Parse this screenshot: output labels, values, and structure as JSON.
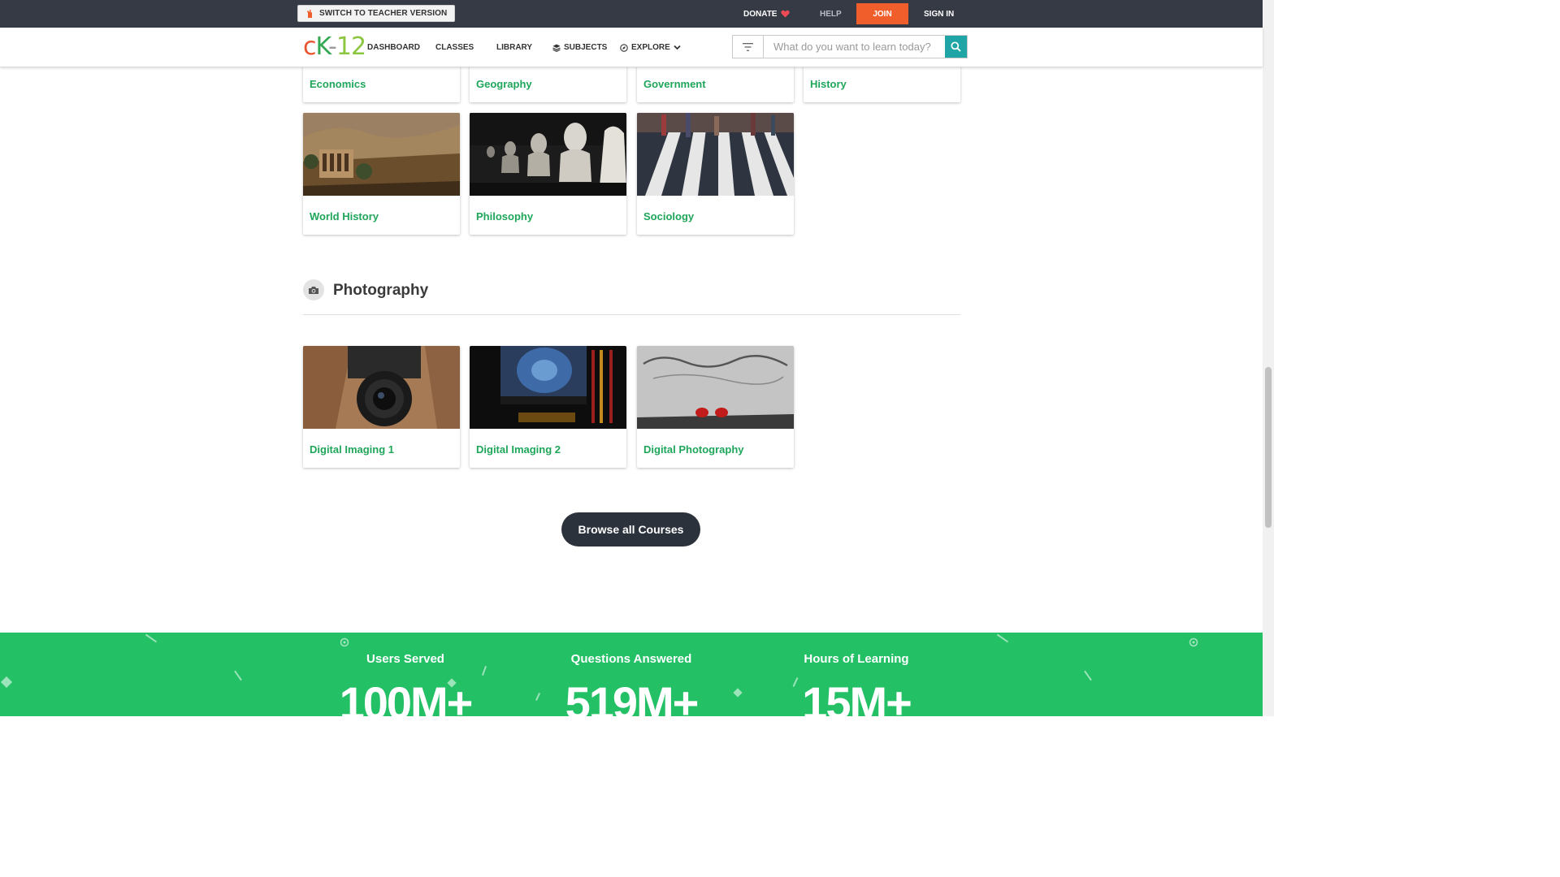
{
  "topbar": {
    "switch_label": "SWITCH TO TEACHER VERSION",
    "donate": "DONATE",
    "help": "HELP",
    "join": "JOIN",
    "signin": "SIGN IN"
  },
  "nav": {
    "logo": {
      "c": "c",
      "k": "K",
      "dash": "-",
      "num": "12"
    },
    "dashboard": "DASHBOARD",
    "classes": "CLASSES",
    "library": "LIBRARY",
    "subjects": "SUBJECTS",
    "explore": "EXPLORE",
    "search_placeholder": "What do you want to learn today?"
  },
  "top_cards": [
    {
      "label": "Economics"
    },
    {
      "label": "Geography"
    },
    {
      "label": "Government"
    },
    {
      "label": "History"
    }
  ],
  "social_cards": [
    {
      "label": "World History"
    },
    {
      "label": "Philosophy"
    },
    {
      "label": "Sociology"
    }
  ],
  "photography_section": {
    "title": "Photography",
    "cards": [
      {
        "label": "Digital Imaging 1"
      },
      {
        "label": "Digital Imaging 2"
      },
      {
        "label": "Digital Photography"
      }
    ]
  },
  "browse_button": "Browse all Courses",
  "stats": [
    {
      "label": "Users Served",
      "value": "100M+"
    },
    {
      "label": "Questions Answered",
      "value": "519M+"
    },
    {
      "label": "Hours of Learning",
      "value": "15M+"
    }
  ],
  "colors": {
    "topbar": "#353a45",
    "join": "#ef5e2b",
    "link_green": "#1fa65a",
    "search_button": "#1fa5a6",
    "stats_green": "#23c065",
    "browse_button": "#2c323c"
  }
}
